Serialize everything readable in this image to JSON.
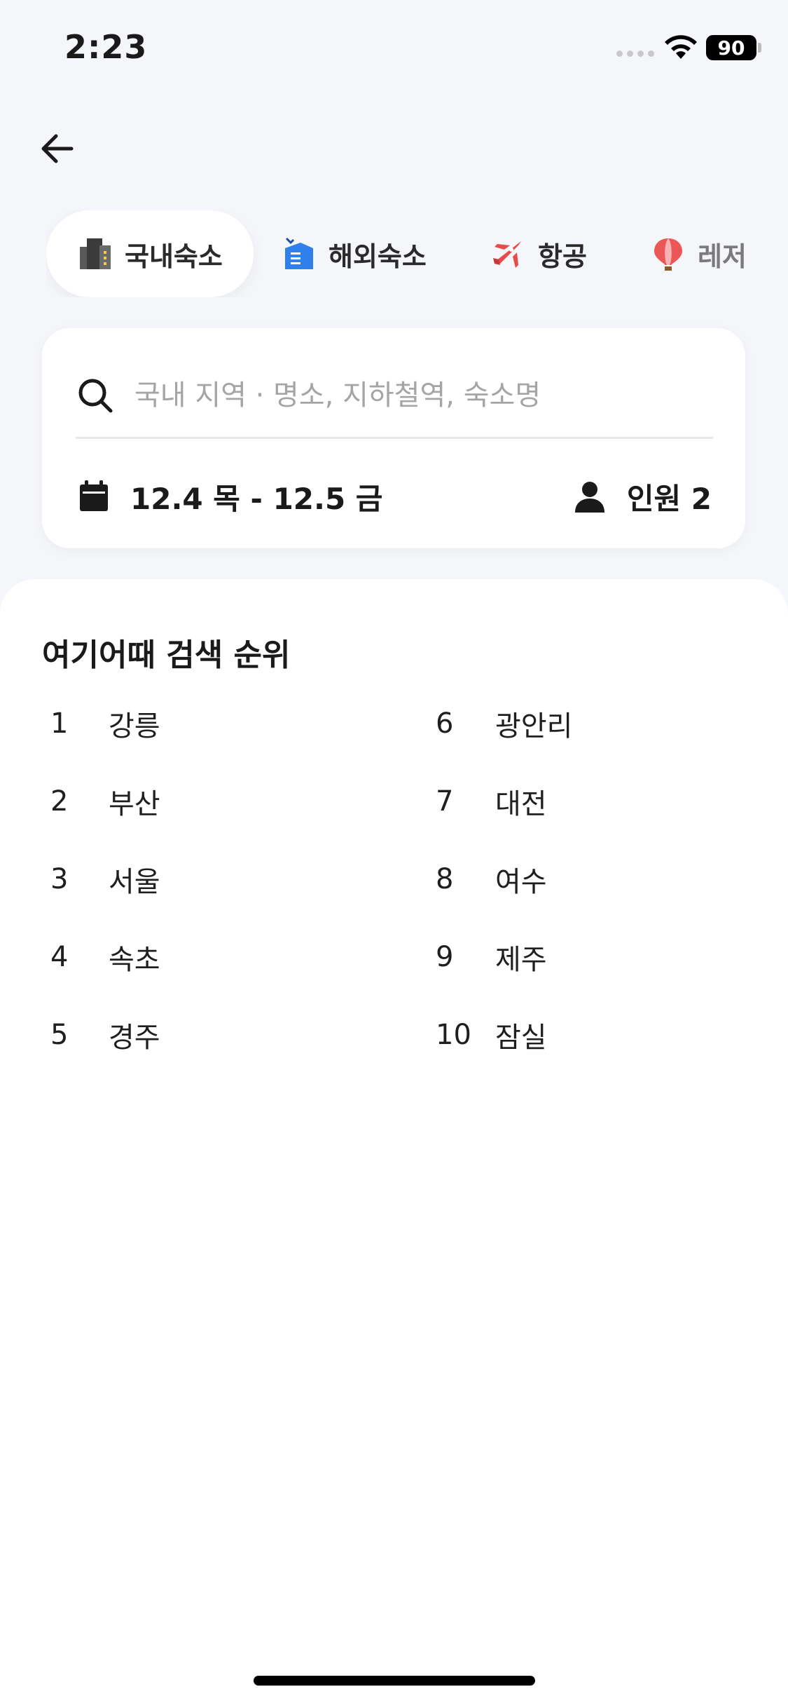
{
  "status_bar": {
    "time": "2:23",
    "battery": "90"
  },
  "tabs": [
    {
      "label": "국내숙소",
      "icon": "building-icon",
      "active": true
    },
    {
      "label": "해외숙소",
      "icon": "overseas-hotel-icon",
      "active": false
    },
    {
      "label": "항공",
      "icon": "airplane-icon",
      "active": false
    },
    {
      "label": "레저",
      "icon": "hot-air-balloon-icon",
      "active": false
    }
  ],
  "search": {
    "placeholder": "국내 지역 · 명소, 지하철역, 숙소명",
    "date": "12.4 목 - 12.5 금",
    "people": "인원 2"
  },
  "ranking": {
    "title": "여기어때 검색 순위",
    "left": [
      {
        "rank": "1",
        "name": "강릉"
      },
      {
        "rank": "2",
        "name": "부산"
      },
      {
        "rank": "3",
        "name": "서울"
      },
      {
        "rank": "4",
        "name": "속초"
      },
      {
        "rank": "5",
        "name": "경주"
      }
    ],
    "right": [
      {
        "rank": "6",
        "name": "광안리"
      },
      {
        "rank": "7",
        "name": "대전"
      },
      {
        "rank": "8",
        "name": "여수"
      },
      {
        "rank": "9",
        "name": "제주"
      },
      {
        "rank": "10",
        "name": "잠실"
      }
    ]
  },
  "colors": {
    "background": "#f5f6fa",
    "card": "#ffffff",
    "text": "#1a1a1a",
    "placeholder": "#a5a5a8"
  }
}
